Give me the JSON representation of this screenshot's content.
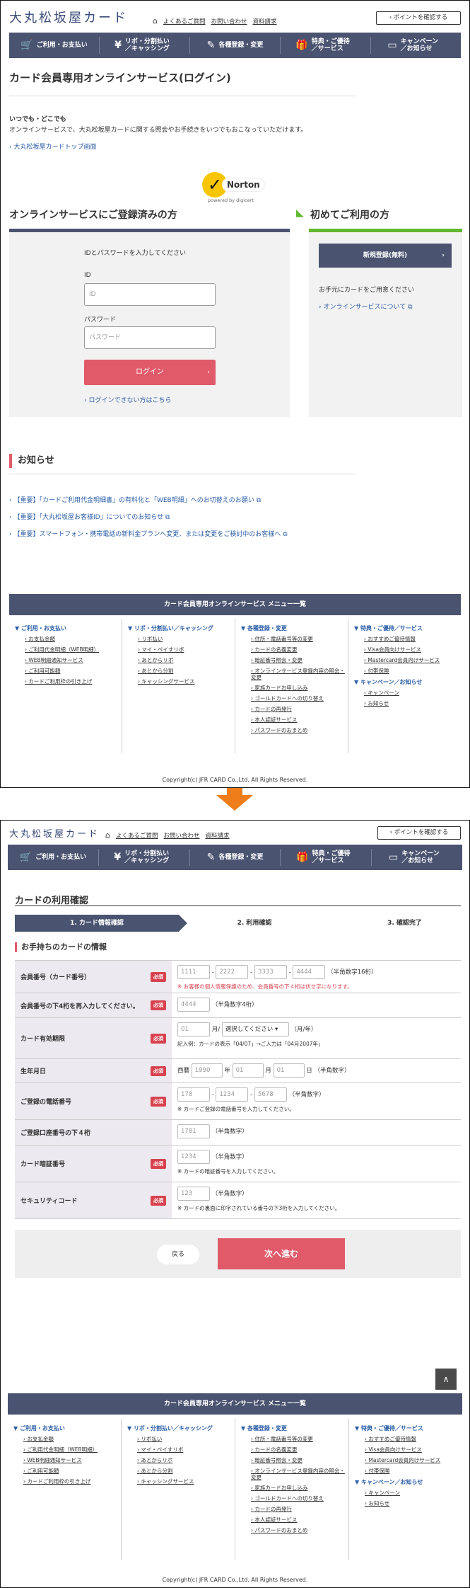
{
  "header": {
    "logo": "大丸松坂屋カード",
    "faq": "よくあるご質問",
    "contact": "お問い合わせ",
    "docs": "資料請求",
    "points_button": "ポイントを確認する"
  },
  "nav": [
    {
      "icon": "cart-icon",
      "glyph": "🛒",
      "label": "ご利用・お支払い"
    },
    {
      "icon": "yen-icon",
      "glyph": "¥",
      "label": "リボ・分割払い／キャッシング"
    },
    {
      "icon": "edit-icon",
      "glyph": "✎",
      "label": "各種登録・変更"
    },
    {
      "icon": "gift-icon",
      "glyph": "🎁",
      "label": "特典・ご優待／サービス"
    },
    {
      "icon": "info-icon",
      "glyph": "▭",
      "label": "キャンペーン／お知らせ"
    }
  ],
  "login_page": {
    "title": "カード会員専用オンラインサービス(ログイン)",
    "lead_title": "いつでも・どこでも",
    "lead_text": "オンラインサービスで、大丸松坂屋カードに関する照会やお手続きをいつでもおこなっていただけます。",
    "top_link": "大丸松坂屋カードトップ画面",
    "norton": {
      "name": "Norton",
      "powered": "powered by digicert"
    },
    "registered_heading": "オンラインサービスにご登録済みの方",
    "login_lead": "IDとパスワードを入力してください",
    "id_label": "ID",
    "id_placeholder": "ID",
    "pw_label": "パスワード",
    "pw_placeholder": "パスワード",
    "login_button": "ログイン",
    "cant_login": "ログインできない方はこちら",
    "new_heading": "初めてご利用の方",
    "new_button": "新規登録(無料)",
    "new_text": "お手元にカードをご用意ください",
    "new_link": "オンラインサービスについて",
    "news_heading": "お知らせ",
    "news": [
      "【重要】「カードご利用代金明細書」の有料化と「WEB明細」へのお切替えのお願い",
      "【重要】「大丸松坂屋お客様ID」についてのお知らせ",
      "【重要】スマートフォン・携帯電話の新料金プランへ変更、または変更をご検討中のお客様へ"
    ]
  },
  "menu": {
    "title": "カード会員専用オンラインサービス メニュー一覧",
    "columns": [
      {
        "cat": "ご利用・お支払い",
        "items": [
          "お支払金額",
          "ご利用代金明細（WEB明細）",
          "WEB明細通知サービス",
          "ご利用可能額",
          "カードご利用枠の引き上げ"
        ]
      },
      {
        "cat": "リボ・分割払い／キャッシング",
        "items": [
          "リボ払い",
          "マイ・ペイすリボ",
          "あとからリボ",
          "あとから分割",
          "キャッシングサービス"
        ]
      },
      {
        "cat": "各種登録・変更",
        "items": [
          "住所・電話番号等の変更",
          "カードの名義変更",
          "暗証番号照会・変更",
          "オンラインサービス登録内容の照会・変更",
          "家族カードお申し込み",
          "ゴールドカードへの切り替え",
          "カードの再発行",
          "本人認証サービス",
          "パスワードのおまとめ"
        ]
      },
      {
        "cat": "特典・ご優待／サービス",
        "items": [
          "おすすめご優待情報",
          "Visa会員向けサービス",
          "Mastercard会員向けサービス",
          "付帯保険"
        ],
        "cat2": "キャンペーン／お知らせ",
        "items2": [
          "キャンペーン",
          "お知らせ"
        ]
      }
    ]
  },
  "copyright": "Copyright(c) JFR CARD Co.,Ltd. All Rights Reserved.",
  "confirm_page": {
    "title": "カードの利用確認",
    "steps": [
      "1. カード情報確認",
      "2. 利用確認",
      "3. 確認完了"
    ],
    "section": "お手持ちのカードの情報",
    "required": "必須",
    "card_no": {
      "label": "会員番号（カード番号）",
      "ph": [
        "1111",
        "2222",
        "3333",
        "4444"
      ],
      "hint": "（半角数字16桁）",
      "note": "※ お客様の個人情報保護のため、会員番号の下４桁は伏せ字になります。"
    },
    "last4": {
      "label": "会員番号の下4桁を再入力してください。",
      "ph": "4444",
      "hint": "（半角数字4桁）"
    },
    "expiry": {
      "label": "カード有効期限",
      "month_ph": "01",
      "month_unit": "月/",
      "year_select": "選択してください",
      "year_unit": "（月/年）",
      "note": "記入例：カードの表示「04/07」→ご入力は「04月2007年」"
    },
    "birth": {
      "label": "生年月日",
      "era": "西暦",
      "year_ph": "1990",
      "year_unit": "年",
      "month_ph": "01",
      "month_unit": "月",
      "day_ph": "01",
      "day_unit": "日",
      "hint": "（半角数字）"
    },
    "phone": {
      "label": "ご登録の電話番号",
      "ph": [
        "178",
        "1234",
        "5678"
      ],
      "hint": "（半角数字）",
      "note": "※ カードご登録の電話番号を入力してください。"
    },
    "bank4": {
      "label": "ご登録口座番号の下４桁",
      "ph": "1781",
      "hint": "（半角数字）"
    },
    "pin": {
      "label": "カード暗証番号",
      "ph": "1234",
      "hint": "（半角数字）",
      "note": "※ カードの暗証番号を入力してください。"
    },
    "cvc": {
      "label": "セキュリティコード",
      "ph": "123",
      "hint": "（半角数字）",
      "note": "※ カードの裏面に印字されている番号の下3桁を入力してください。"
    },
    "back_button": "戻る",
    "next_button": "次へ進む",
    "totop": "∧"
  },
  "colors": {
    "navy": "#4a5370",
    "pink": "#e05a6a",
    "green": "#62b82f",
    "red": "#d8424f",
    "link": "#2a5ea8",
    "arrow": "#ef7d1a"
  }
}
